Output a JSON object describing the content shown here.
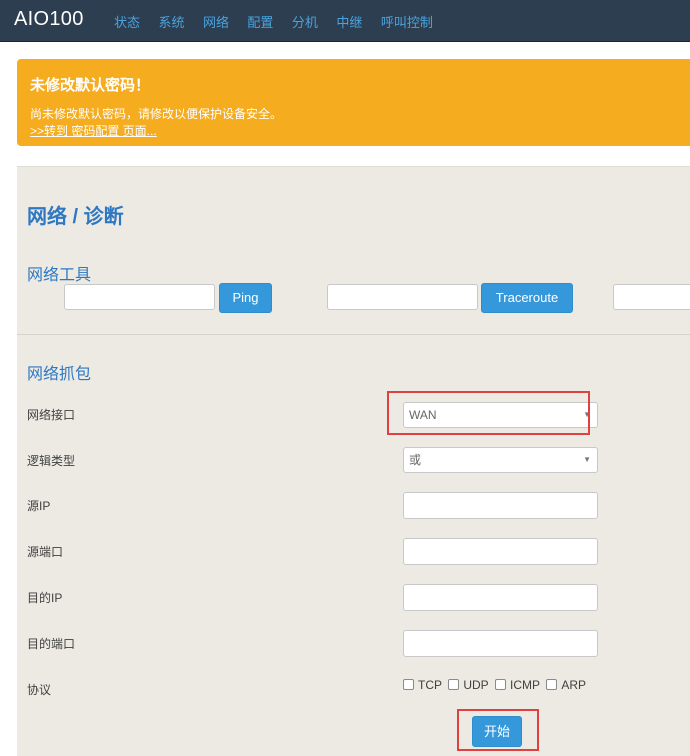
{
  "navbar": {
    "brand": "AIO100",
    "items": [
      {
        "label": "状态"
      },
      {
        "label": "系统"
      },
      {
        "label": "网络"
      },
      {
        "label": "配置"
      },
      {
        "label": "分机"
      },
      {
        "label": "中继"
      },
      {
        "label": "呼叫控制"
      }
    ]
  },
  "alert": {
    "title": "未修改默认密码！",
    "text": "尚未修改默认密码，请修改以便保护设备安全。",
    "link": ">>转到 密码配置 页面..."
  },
  "page": {
    "title": "网络 / 诊断"
  },
  "tools": {
    "title": "网络工具",
    "ping_button": "Ping",
    "traceroute_button": "Traceroute",
    "ping_value": "",
    "traceroute_value": "",
    "third_value": ""
  },
  "capture": {
    "title": "网络抓包",
    "interface_label": "网络接口",
    "interface_value": "WAN",
    "logic_label": "逻辑类型",
    "logic_value": "或",
    "src_ip_label": "源IP",
    "src_port_label": "源端口",
    "dst_ip_label": "目的IP",
    "dst_port_label": "目的端口",
    "protocol_label": "协议",
    "protocols": [
      {
        "label": "TCP",
        "checked": false
      },
      {
        "label": "UDP",
        "checked": false
      },
      {
        "label": "ICMP",
        "checked": false
      },
      {
        "label": "ARP",
        "checked": false
      }
    ],
    "start_button": "开始"
  },
  "colors": {
    "navbar_bg": "#2c3e50",
    "nav_link": "#4aa3df",
    "alert_bg": "#f5ac1e",
    "accent": "#3498db",
    "title_blue": "#2e78c2",
    "panel_bg": "#eceae3",
    "highlight_red": "#e04040"
  },
  "icons": {
    "select_caret": "▼"
  }
}
